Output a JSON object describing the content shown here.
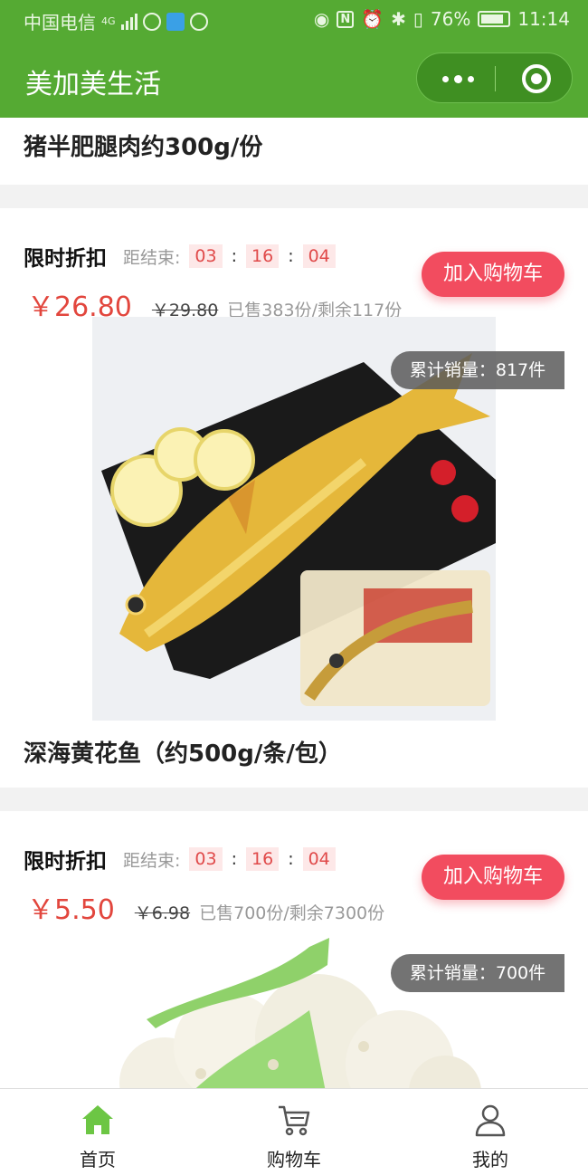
{
  "status_bar": {
    "carrier": "中国电信",
    "network": "4G",
    "battery": "76%",
    "time": "11:14"
  },
  "title_bar": {
    "title": "美加美生活"
  },
  "previous_item": {
    "name": "猪半肥腿肉约300g/份"
  },
  "products": [
    {
      "promo_label": "限时折扣",
      "countdown_label": "距结束:",
      "countdown": [
        "03",
        "16",
        "04"
      ],
      "price": "￥26.80",
      "old_price": "￥29.80",
      "sold_info": "已售383份/剩余117份",
      "cart_button": "加入购物车",
      "sales_badge": "累计销量：817件",
      "name": "深海黄花鱼（约500g/条/包）"
    },
    {
      "promo_label": "限时折扣",
      "countdown_label": "距结束:",
      "countdown": [
        "03",
        "16",
        "04"
      ],
      "price": "￥5.50",
      "old_price": "￥6.98",
      "sold_info": "已售700份/剩余7300份",
      "cart_button": "加入购物车",
      "sales_badge": "累计销量：700件"
    }
  ],
  "tab_bar": {
    "tabs": [
      {
        "label": "首页",
        "icon": "home-icon",
        "active": true
      },
      {
        "label": "购物车",
        "icon": "cart-icon",
        "active": false
      },
      {
        "label": "我的",
        "icon": "user-icon",
        "active": false
      }
    ]
  },
  "colors": {
    "brand_green": "#55aa33",
    "price_red": "#e2463d",
    "button_red": "#f24c5f",
    "active_tab": "#6cc644"
  }
}
